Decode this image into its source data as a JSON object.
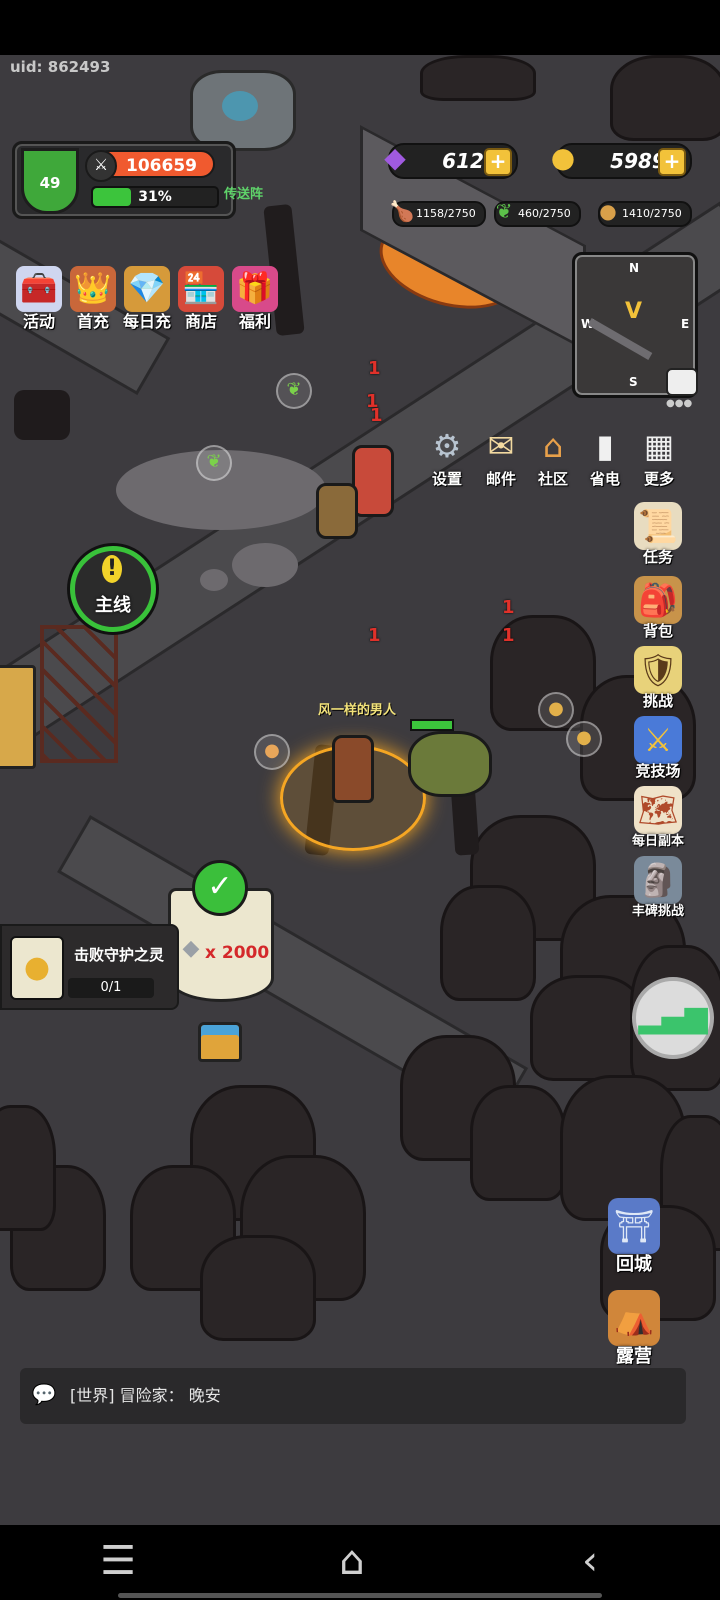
{
  "hud": {
    "uid_text": "uid: 862493",
    "level": "49",
    "combat_power": "106659",
    "exp_percent_text": "31%",
    "exp_fraction": 0.31,
    "portal_label": "传送阵"
  },
  "currency": {
    "gems": "6120",
    "gold": "5989",
    "food": "1158/2750",
    "herb": "460/2750",
    "ore": "1410/2750"
  },
  "top_menu": [
    {
      "label": "活动",
      "icon": "gift-chest-icon",
      "emoji": "🧰"
    },
    {
      "label": "首充",
      "icon": "crowned-hero-icon",
      "emoji": "👑"
    },
    {
      "label": "每日充",
      "icon": "gem-basket-icon",
      "emoji": "💎"
    },
    {
      "label": "商店",
      "icon": "shop-stall-icon",
      "emoji": "🏪"
    },
    {
      "label": "福利",
      "icon": "gift-box-icon",
      "emoji": "🎁"
    }
  ],
  "minimap": {
    "n": "N",
    "s": "S",
    "w": "W",
    "e": "E"
  },
  "system_menu": [
    {
      "label": "设置",
      "icon": "gear-icon",
      "emoji": "⚙"
    },
    {
      "label": "邮件",
      "icon": "mail-icon",
      "emoji": "✉"
    },
    {
      "label": "社区",
      "icon": "house-icon",
      "emoji": "🏠"
    },
    {
      "label": "省电",
      "icon": "battery-icon",
      "emoji": "🔋"
    },
    {
      "label": "更多",
      "icon": "grid-icon",
      "emoji": "▦"
    }
  ],
  "side_menu": [
    {
      "label": "任务",
      "icon": "scroll-icon",
      "emoji": "📜"
    },
    {
      "label": "背包",
      "icon": "backpack-icon",
      "emoji": "🎒"
    },
    {
      "label": "挑战",
      "icon": "shield-sword-icon",
      "emoji": "🛡"
    },
    {
      "label": "竞技场",
      "icon": "arena-crest-icon",
      "emoji": "⚔"
    },
    {
      "label": "每日副本",
      "icon": "daily-map-icon",
      "emoji": "🗺"
    },
    {
      "label": "丰碑挑战",
      "icon": "monument-icon",
      "emoji": "🗿"
    }
  ],
  "bottom_right": {
    "return_city": "回城",
    "camp": "露营"
  },
  "quest": {
    "mark": "!",
    "label": "主线",
    "task_name": "击败守护之灵",
    "task_progress": "0/1"
  },
  "reward": {
    "amount": "x 2000"
  },
  "scene": {
    "player_name": "风一样的男人",
    "damage_numbers": [
      "1",
      "1",
      "1",
      "1",
      "1",
      "1"
    ]
  },
  "chat": {
    "channel": "[世界]",
    "sender": "冒险家：",
    "message": "晚安"
  },
  "colors": {
    "accent_green": "#3cc43c",
    "power_orange": "#f05a2f",
    "gold": "#f2c23a",
    "map_ground": "#3d3b3f"
  }
}
